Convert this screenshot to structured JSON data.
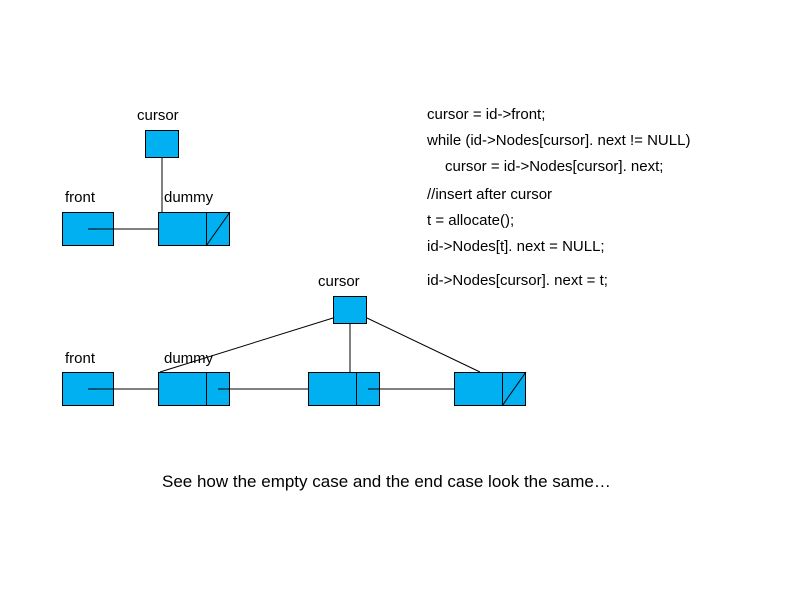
{
  "labels": {
    "cursor_top": "cursor",
    "front1": "front",
    "dummy1": "dummy",
    "cursor_mid": "cursor",
    "front2": "front",
    "dummy2": "dummy"
  },
  "code": {
    "l1": "cursor = id->front;",
    "l2": "while (id->Nodes[cursor]. next != NULL)",
    "l3": "cursor = id->Nodes[cursor]. next;",
    "l4": "//insert after cursor",
    "l5": "t = allocate();",
    "l6": "id->Nodes[t]. next = NULL;",
    "l7": "id->Nodes[cursor]. next = t;"
  },
  "footer": "See how the empty case and the end case look the same…",
  "colors": {
    "node": "#00B0F0"
  }
}
